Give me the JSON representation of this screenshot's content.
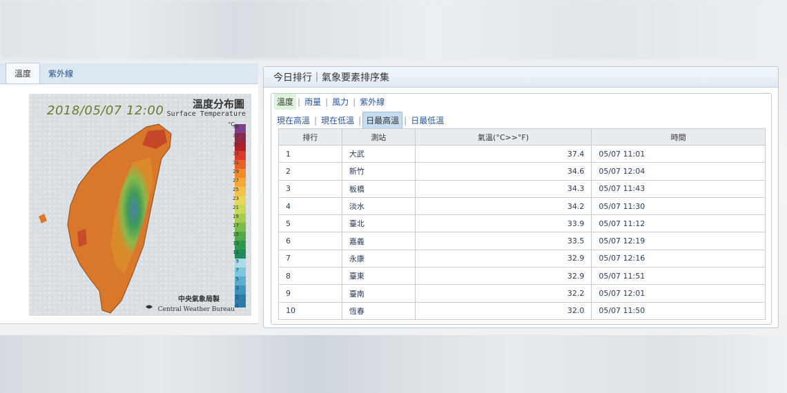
{
  "left_panel": {
    "tabs": [
      {
        "label": "溫度",
        "active": true
      },
      {
        "label": "紫外線",
        "active": false
      }
    ],
    "map": {
      "date": "2018/05/07 12:00",
      "title": "溫度分布圖",
      "subtitle": "Surface Temperature",
      "unit": "°C",
      "scale_labels": [
        "38",
        "37",
        "35",
        "33",
        "31",
        "29",
        "27",
        "25",
        "23",
        "21",
        "19",
        "17",
        "15",
        "13",
        "11",
        "9",
        "7",
        "5",
        "3",
        "1",
        "-1"
      ],
      "credit_cn": "中央氣象局製",
      "credit_en": "Central Weather Bureau"
    }
  },
  "right_panel": {
    "header_title": "今日排行｜氣象要素排序集",
    "element_tabs": [
      "溫度",
      "雨量",
      "風力",
      "紫外線"
    ],
    "active_element": "溫度",
    "sub_tabs": [
      "現在高溫",
      "現在低溫",
      "日最高溫",
      "日最低溫"
    ],
    "active_sub": "日最高溫",
    "table": {
      "headers": [
        "排行",
        "測站",
        "氣溫(°C>>°F)",
        "時間"
      ],
      "rows": [
        [
          "1",
          "大武",
          "37.4",
          "05/07 11:01"
        ],
        [
          "2",
          "新竹",
          "34.6",
          "05/07 12:04"
        ],
        [
          "3",
          "板橋",
          "34.3",
          "05/07 11:43"
        ],
        [
          "4",
          "淡水",
          "34.2",
          "05/07 11:30"
        ],
        [
          "5",
          "臺北",
          "33.9",
          "05/07 11:12"
        ],
        [
          "6",
          "嘉義",
          "33.5",
          "05/07 12:19"
        ],
        [
          "7",
          "永康",
          "32.9",
          "05/07 12:16"
        ],
        [
          "8",
          "臺東",
          "32.9",
          "05/07 11:51"
        ],
        [
          "9",
          "臺南",
          "32.2",
          "05/07 12:01"
        ],
        [
          "10",
          "恆春",
          "32.0",
          "05/07 11:50"
        ]
      ]
    }
  },
  "colors": {
    "tab_bar": "#dce7f2",
    "active_filter": "#dff2dc",
    "active_sub_filter": "#c6dcf0",
    "link": "#2255a0"
  }
}
